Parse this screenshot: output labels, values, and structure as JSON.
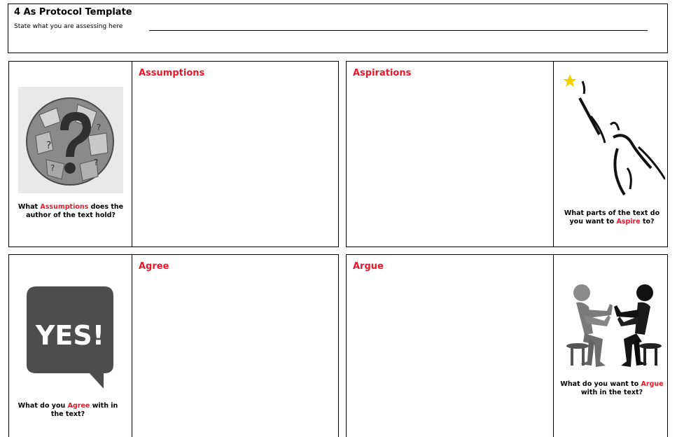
{
  "header": {
    "title": "4 As Protocol Template",
    "prompt": "State what you are assessing here"
  },
  "panels": {
    "assumptions": {
      "heading": "Assumptions",
      "q_pre": "What ",
      "q_key": "Assumptions",
      "q_post": " does the author of the text hold?",
      "image_icon": "puzzle-globe-question-icon"
    },
    "aspirations": {
      "heading": "Aspirations",
      "q_pre": "What parts of the text do you want to ",
      "q_key": "Aspire",
      "q_post": " to?",
      "image_icon": "reaching-for-star-icon"
    },
    "agree": {
      "heading": "Agree",
      "q_pre": "What do you ",
      "q_key": "Agree",
      "q_post": " with in the text?",
      "image_icon": "yes-speech-bubble-icon",
      "bubble_text": "YES!"
    },
    "argue": {
      "heading": "Argue",
      "q_pre": "What do you want to ",
      "q_key": "Argue",
      "q_post": " with in the text?",
      "image_icon": "two-people-arguing-icon"
    }
  },
  "colors": {
    "accent": "#e8182a",
    "star": "#f4d000"
  }
}
